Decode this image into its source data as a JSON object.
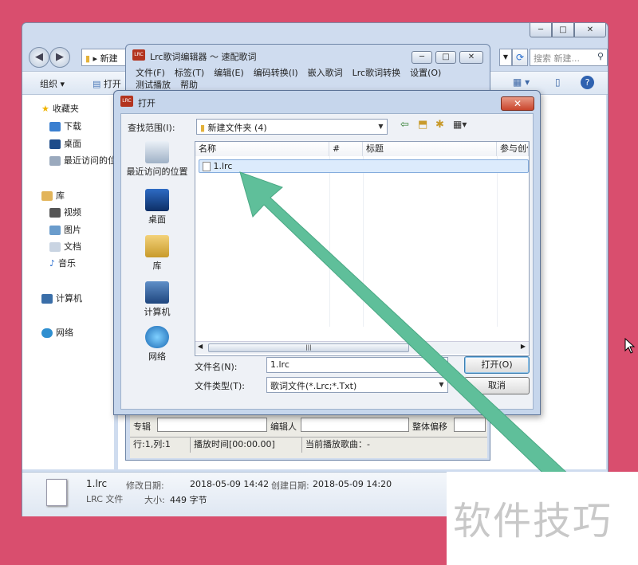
{
  "colors": {
    "background": "#d94e6e",
    "arrow": "#5fbf9a",
    "window_frame": "#cfdcef"
  },
  "explorer": {
    "address": "新建",
    "search_placeholder": "搜索 新建...",
    "toolbar": {
      "organize": "组织",
      "open": "打开"
    },
    "sidebar": {
      "favorites": "收藏夹",
      "downloads": "下载",
      "desktop": "桌面",
      "recent": "最近访问的位",
      "libraries": "库",
      "videos": "视频",
      "pictures": "图片",
      "documents": "文档",
      "music": "音乐",
      "computer": "计算机",
      "network": "网络"
    },
    "details": {
      "file_name": "1.lrc",
      "file_type": "LRC 文件",
      "modified_label": "修改日期:",
      "modified": "2018-05-09 14:42",
      "created_label": "创建日期:",
      "created": "2018-05-09 14:20",
      "size_label": "大小:",
      "size": "449 字节"
    }
  },
  "lrc_editor": {
    "title": "Lrc歌词编辑器 ～ 速配歌词",
    "menu": [
      "文件(F)",
      "标签(T)",
      "编辑(E)",
      "编码转换(I)",
      "嵌入歌词",
      "Lrc歌词转换",
      "设置(O)"
    ],
    "menu2": [
      "测试播放",
      "帮助"
    ],
    "album_label": "专辑",
    "editor_label": "编辑人",
    "offset_label": "整体偏移",
    "status": {
      "position": "行:1,列:1",
      "play_time": "播放时间[00:00.00]",
      "current_song": "当前播放歌曲：-"
    }
  },
  "open_dialog": {
    "title": "打开",
    "look_in_label": "查找范围(I):",
    "look_in_value": "新建文件夹 (4)",
    "places": [
      "最近访问的位置",
      "桌面",
      "库",
      "计算机",
      "网络"
    ],
    "columns": [
      "名称",
      "#",
      "标题",
      "参与创作"
    ],
    "files": [
      {
        "name": "1.lrc"
      }
    ],
    "filename_label": "文件名(N):",
    "filename_value": "1.lrc",
    "filetype_label": "文件类型(T):",
    "filetype_value": "歌词文件(*.Lrc;*.Txt)",
    "open_button": "打开(O)",
    "cancel_button": "取消"
  },
  "watermark": "软件技巧"
}
